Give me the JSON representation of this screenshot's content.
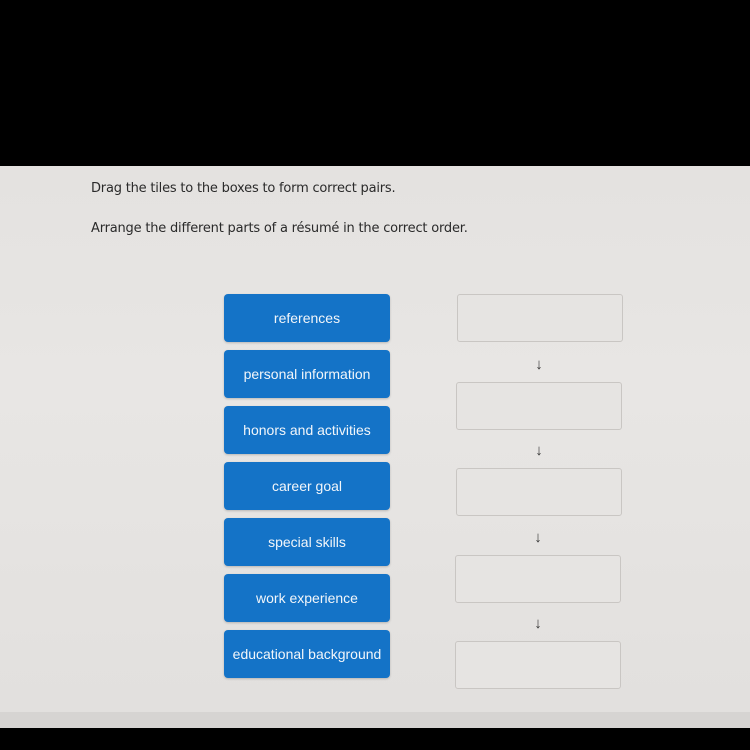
{
  "instructions": {
    "line1": "Drag the tiles to the boxes to form correct pairs.",
    "line2": "Arrange the different parts of a résumé in the correct order."
  },
  "tiles": [
    {
      "label": "references"
    },
    {
      "label": "personal information"
    },
    {
      "label": "honors and activities"
    },
    {
      "label": "career goal"
    },
    {
      "label": "special skills"
    },
    {
      "label": "work experience"
    },
    {
      "label": "educational background"
    }
  ],
  "drop_boxes": [
    {
      "value": ""
    },
    {
      "value": ""
    },
    {
      "value": ""
    },
    {
      "value": ""
    },
    {
      "value": ""
    }
  ],
  "arrow_glyph": "↓",
  "colors": {
    "tile_blue": "#1473c7",
    "tile_text": "#f2f6fa"
  }
}
